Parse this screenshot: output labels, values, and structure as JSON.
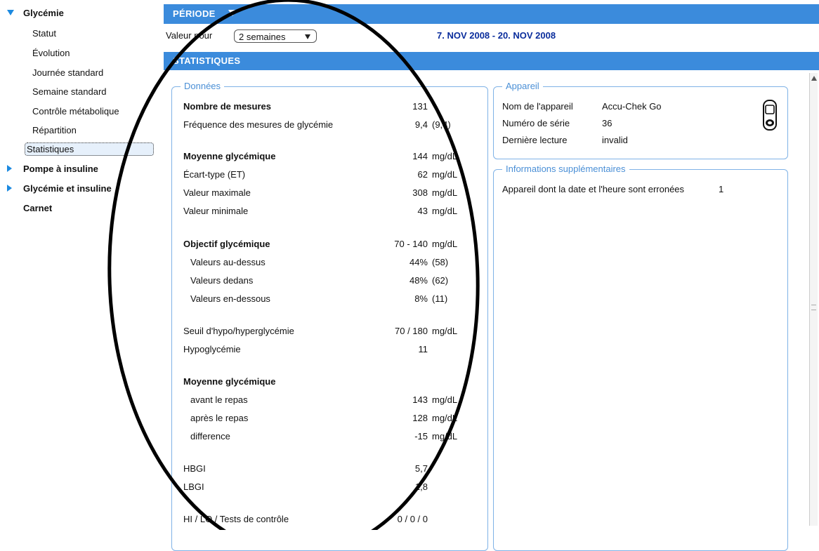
{
  "sidebar": {
    "groups": [
      {
        "label": "Glycémie",
        "expanded": true,
        "items": [
          "Statut",
          "Évolution",
          "Journée standard",
          "Semaine standard",
          "Contrôle métabolique",
          "Répartition",
          "Statistiques"
        ],
        "selected": "Statistiques"
      },
      {
        "label": "Pompe à insuline",
        "expanded": false
      },
      {
        "label": "Glycémie et insuline",
        "expanded": false
      },
      {
        "label": "Carnet",
        "expanded": false
      }
    ]
  },
  "period": {
    "header": "PÉRIODE",
    "value_label": "Valeur pour",
    "select_value": "2 semaines",
    "range": "7. NOV 2008 - 20. NOV 2008"
  },
  "stats": {
    "header": "STATISTIQUES",
    "donnees": {
      "legend": "Données",
      "rows": [
        {
          "label": "Nombre de mesures",
          "value": "131",
          "unit": "",
          "bold": true
        },
        {
          "label": "Fréquence des mesures de glycémie",
          "value": "9,4",
          "unit": "(9,4)"
        },
        {
          "label": "Moyenne glycémique",
          "value": "144",
          "unit": "mg/dL",
          "bold": true
        },
        {
          "label": "Écart-type (ET)",
          "value": "62",
          "unit": "mg/dL"
        },
        {
          "label": "Valeur maximale",
          "value": "308",
          "unit": "mg/dL"
        },
        {
          "label": "Valeur minimale",
          "value": "43",
          "unit": "mg/dL"
        },
        {
          "label": "Objectif glycémique",
          "value": "70 - 140",
          "unit": "mg/dL",
          "bold": true
        },
        {
          "label": "Valeurs au-dessus",
          "value": "44%",
          "unit": "(58)",
          "indent": true
        },
        {
          "label": "Valeurs dedans",
          "value": "48%",
          "unit": "(62)",
          "indent": true
        },
        {
          "label": "Valeurs en-dessous",
          "value": "8%",
          "unit": "(11)",
          "indent": true
        },
        {
          "label": "Seuil d'hypo/hyperglycémie",
          "value": "70 / 180",
          "unit": "mg/dL"
        },
        {
          "label": "Hypoglycémie",
          "value": "11",
          "unit": ""
        },
        {
          "label": "Moyenne glycémique",
          "value": "",
          "unit": "",
          "bold": true
        },
        {
          "label": "avant le repas",
          "value": "143",
          "unit": "mg/dL",
          "indent": true
        },
        {
          "label": "après le repas",
          "value": "128",
          "unit": "mg/dL",
          "indent": true
        },
        {
          "label": "difference",
          "value": "-15",
          "unit": "mg/dL",
          "indent": true
        },
        {
          "label": "HBGI",
          "value": "5,7",
          "unit": ""
        },
        {
          "label": "LBGI",
          "value": "1,8",
          "unit": ""
        },
        {
          "label": "HI / LO / Tests de contrôle",
          "value": "0 / 0 / 0",
          "unit": ""
        }
      ]
    },
    "appareil": {
      "legend": "Appareil",
      "rows": [
        {
          "label": "Nom de l'appareil",
          "value": "Accu-Chek Go"
        },
        {
          "label": "Numéro de série",
          "value": "36"
        },
        {
          "label": "Dernière lecture",
          "value": "invalid"
        }
      ],
      "icon": "glucose-meter-icon"
    },
    "info": {
      "legend": "Informations supplémentaires",
      "row_label": "Appareil dont la date et l'heure sont erronées",
      "row_value": "1"
    }
  },
  "colors": {
    "accent": "#3b8bdc",
    "legend": "#4a8fd6",
    "range_text": "#0a2d9c",
    "border": "#7fb2e6"
  }
}
